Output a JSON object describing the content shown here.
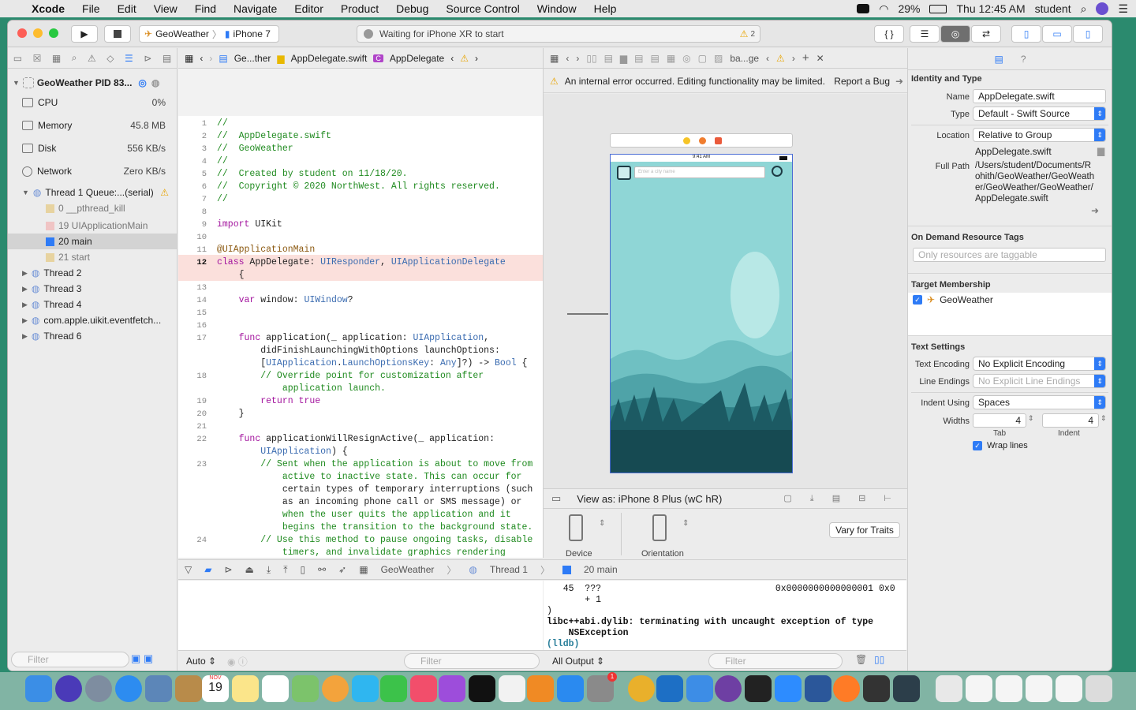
{
  "menubar": {
    "app_name": "Xcode",
    "items": [
      "File",
      "Edit",
      "View",
      "Find",
      "Navigate",
      "Editor",
      "Product",
      "Debug",
      "Source Control",
      "Window",
      "Help"
    ],
    "battery": "29%",
    "clock": "Thu 12:45 AM",
    "user": "student"
  },
  "toolbar": {
    "scheme": "GeoWeather",
    "device": "iPhone 7",
    "status": "Waiting for iPhone XR to start",
    "warning_count": "2"
  },
  "navigator": {
    "process": "GeoWeather PID 83...",
    "gauges": [
      {
        "label": "CPU",
        "value": "0%"
      },
      {
        "label": "Memory",
        "value": "45.8 MB"
      },
      {
        "label": "Disk",
        "value": "556 KB/s"
      },
      {
        "label": "Network",
        "value": "Zero KB/s"
      }
    ],
    "thread1": "Thread 1 Queue:...(serial)",
    "frames": [
      "0 __pthread_kill",
      "19 UIApplicationMain",
      "20 main",
      "21 start"
    ],
    "threads": [
      "Thread 2",
      "Thread 3",
      "Thread 4",
      "com.apple.uikit.eventfetch...",
      "Thread 6"
    ],
    "filter_placeholder": "Filter"
  },
  "editor": {
    "jump": [
      "Ge...ther",
      "AppDelegate.swift",
      "AppDelegate"
    ],
    "lines": [
      {
        "n": "1",
        "t": "//"
      },
      {
        "n": "2",
        "t": "//  AppDelegate.swift"
      },
      {
        "n": "3",
        "t": "//  GeoWeather"
      },
      {
        "n": "4",
        "t": "//"
      },
      {
        "n": "5",
        "t": "//  Created by student on 11/18/20."
      },
      {
        "n": "6",
        "t": "//  Copyright © 2020 NorthWest. All rights reserved."
      },
      {
        "n": "7",
        "t": "//"
      },
      {
        "n": "8",
        "t": ""
      },
      {
        "n": "9",
        "t": "import UIKit"
      },
      {
        "n": "10",
        "t": ""
      },
      {
        "n": "11",
        "t": "@UIApplicationMain"
      },
      {
        "n": "12",
        "t": "class AppDelegate: UIResponder, UIApplicationDelegate"
      },
      {
        "n": "",
        "t": "    {"
      },
      {
        "n": "13",
        "t": ""
      },
      {
        "n": "14",
        "t": "    var window: UIWindow?"
      },
      {
        "n": "15",
        "t": ""
      },
      {
        "n": "16",
        "t": ""
      },
      {
        "n": "17",
        "t": "    func application(_ application: UIApplication,"
      },
      {
        "n": "",
        "t": "        didFinishLaunchingWithOptions launchOptions:"
      },
      {
        "n": "",
        "t": "        [UIApplication.LaunchOptionsKey: Any]?) -> Bool {"
      },
      {
        "n": "18",
        "t": "        // Override point for customization after"
      },
      {
        "n": "",
        "t": "            application launch."
      },
      {
        "n": "19",
        "t": "        return true"
      },
      {
        "n": "20",
        "t": "    }"
      },
      {
        "n": "21",
        "t": ""
      },
      {
        "n": "22",
        "t": "    func applicationWillResignActive(_ application:"
      },
      {
        "n": "",
        "t": "        UIApplication) {"
      },
      {
        "n": "23",
        "t": "        // Sent when the application is about to move from"
      },
      {
        "n": "",
        "t": "            active to inactive state. This can occur for"
      },
      {
        "n": "",
        "t": "            certain types of temporary interruptions (such"
      },
      {
        "n": "",
        "t": "            as an incoming phone call or SMS message) or"
      },
      {
        "n": "",
        "t": "            when the user quits the application and it"
      },
      {
        "n": "",
        "t": "            begins the transition to the background state."
      },
      {
        "n": "24",
        "t": "        // Use this method to pause ongoing tasks, disable"
      },
      {
        "n": "",
        "t": "            timers, and invalidate graphics rendering"
      }
    ]
  },
  "ib": {
    "jump_tail": "ba...ge",
    "error": "An internal error occurred. Editing functionality may be limited.",
    "report": "Report a Bug",
    "phone_time": "9:41 AM",
    "search_placeholder": "Enter a city name",
    "view_as": "View as: iPhone 8 Plus (wC hR)",
    "device_label": "Device",
    "orientation_label": "Orientation",
    "vary": "Vary for Traits"
  },
  "inspector": {
    "identity_title": "Identity and Type",
    "name_label": "Name",
    "name_value": "AppDelegate.swift",
    "type_label": "Type",
    "type_value": "Default - Swift Source",
    "location_label": "Location",
    "location_value": "Relative to Group",
    "location_file": "AppDelegate.swift",
    "fullpath_label": "Full Path",
    "fullpath": "/Users/student/Documents/Rohith/GeoWeather/GeoWeather/GeoWeather/GeoWeather/AppDelegate.swift",
    "odr_title": "On Demand Resource Tags",
    "odr_placeholder": "Only resources are taggable",
    "target_title": "Target Membership",
    "target": "GeoWeather",
    "text_title": "Text Settings",
    "encoding_label": "Text Encoding",
    "encoding_value": "No Explicit Encoding",
    "line_label": "Line Endings",
    "line_value": "No Explicit Line Endings",
    "indent_label": "Indent Using",
    "indent_value": "Spaces",
    "widths_label": "Widths",
    "tab_value": "4",
    "indent_width": "4",
    "tab_label": "Tab",
    "indent_sub": "Indent",
    "wrap": "Wrap lines"
  },
  "debug": {
    "crumbs": [
      "GeoWeather",
      "Thread 1",
      "20 main"
    ],
    "auto": "Auto",
    "output_select": "All Output",
    "console": [
      "   45  ???                                0x0000000000000001 0x0",
      "       + 1",
      ")",
      "libc++abi.dylib: terminating with uncaught exception of type",
      "    NSException",
      "(lldb)"
    ],
    "filter": "Filter"
  },
  "dock": {
    "calendar_month": "NOV",
    "calendar_day": "19",
    "badge": "1"
  },
  "colors": {
    "accent": "#2e7bf6",
    "highlight": "#fbe0dc",
    "phone_sky": "#8fd6d6"
  }
}
